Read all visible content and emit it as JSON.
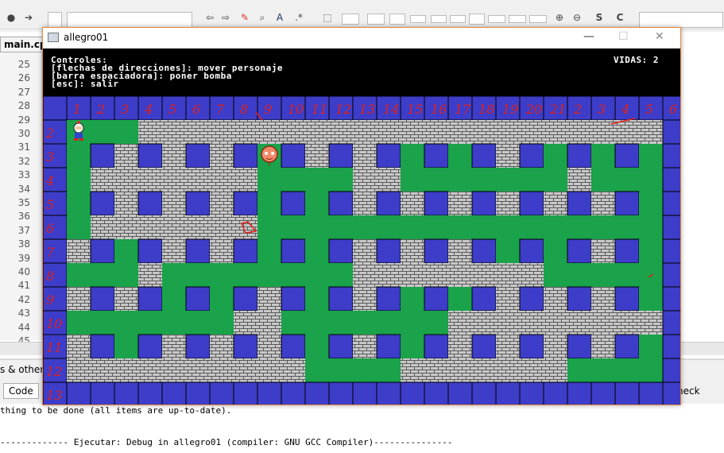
{
  "ide": {
    "editor_tab": "main.cpp",
    "line_numbers": [
      "25",
      "26",
      "27",
      "28",
      "29",
      "30",
      "31",
      "32",
      "33",
      "34",
      "35",
      "36",
      "37",
      "38",
      "39",
      "40",
      "41",
      "42",
      "43",
      "44",
      "45"
    ],
    "bottom_tab_others": "s & others",
    "bottom_tab_code": "Code",
    "bottom_tab_check": "heck",
    "log_line_1": "thing to be done (all items are up-to-date).",
    "log_line_2": "------------- Ejecutar: Debug in allegro01 (compiler: GNU GCC Compiler)---------------"
  },
  "window": {
    "title": "allegro01",
    "minimize": "—",
    "maximize": "☐",
    "close": "✕"
  },
  "hud": {
    "line1": "Controles:",
    "line2": "[flechas de direcciones]: mover personaje",
    "line3": "[barra espaciadora]: poner bomba",
    "line4": "[esc]: salir",
    "lives": "VIDAS: 2"
  },
  "board": {
    "cols": 27,
    "rows": 13,
    "colors": {
      "wall": "#3d3dc9",
      "brick": "#c8c8c8",
      "mortar": "#5a5a5a",
      "floor": "#1aa34a",
      "annotation": "#e0201a"
    },
    "map": [
      "WWWWWWWWWWWWWWWWWWWWWWWWWWW",
      "WFFFBBBBBBBBBBBBBBBBBBBBBBW",
      "WFWBWBWBWFWBWBWFWFWBWFWFWFW",
      "WFBBBBBBBFFFFBBFFFFFFFBFFFW",
      "WFWBWBWBWFWFWBWBWBWBWBWBWFW",
      "WFBBBBBBBFFFFFFFFFFFFFFFFFW",
      "WBWFWBWBWFWFWBWBWBWFWFWBWFW",
      "WFFFBFFFFFFFFBBBBBBBBFFFFFW",
      "WBWBWFWFWBWFWBWFWFWBWBWBWFW",
      "WFFFFFFFBBFFFFFFFBBBBBBBBBW",
      "WBWFWBWBWBWFWBWFWBWBWBWBWFW",
      "WBBBBBBBBBBFFFFBBBBBBBFFFFW",
      "WWWWWWWWWWWWWWWWWWWWWWWWWWW"
    ],
    "player": {
      "col": 1,
      "row": 1,
      "label": "player-bomberman"
    },
    "enemy": {
      "col": 9,
      "row": 2,
      "label": "enemy-balloon"
    },
    "col_annotations": [
      "1",
      "2",
      "3",
      "4",
      "5",
      "6",
      "7",
      "8",
      "9",
      "10",
      "11",
      "12",
      "13",
      "14",
      "15",
      "16",
      "17",
      "18",
      "19",
      "20",
      "21",
      "2",
      "3",
      "4",
      "5",
      "6"
    ],
    "row_annotations": [
      "1",
      "2",
      "3",
      "4",
      "5",
      "6",
      "7",
      "8",
      "9",
      "10",
      "11",
      "12",
      "13"
    ]
  }
}
